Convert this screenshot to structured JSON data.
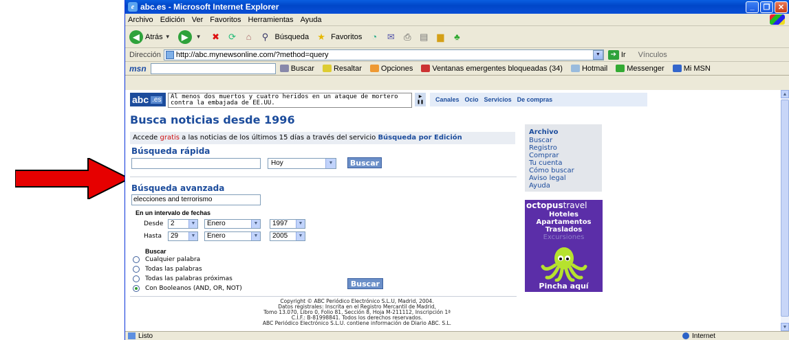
{
  "window": {
    "title": "abc.es - Microsoft Internet Explorer",
    "menu": [
      "Archivo",
      "Edición",
      "Ver",
      "Favoritos",
      "Herramientas",
      "Ayuda"
    ]
  },
  "toolbar": {
    "back_label": "Atrás",
    "search_label": "Búsqueda",
    "favorites_label": "Favoritos"
  },
  "address": {
    "label": "Dirección",
    "url": "http://abc.mynewsonline.com/?method=query",
    "go_label": "Ir",
    "links_label": "Vínculos"
  },
  "msn_bar": {
    "logo": "msn",
    "buscar": "Buscar",
    "resaltar": "Resaltar",
    "opciones": "Opciones",
    "popups": "Ventanas emergentes bloqueadas (34)",
    "hotmail": "Hotmail",
    "messenger": "Messenger",
    "mimsn": "Mi MSN"
  },
  "site": {
    "logo": "abc",
    "logo_suffix": ".es",
    "ticker": "Al menos dos muertos y cuatro heridos en un ataque de mortero contra la embajada de EE.UU.",
    "canales": "Canales",
    "ocio": "Ocio",
    "servicios": "Servicios",
    "compras": "De compras"
  },
  "page": {
    "heading": "Busca noticias desde 1996",
    "promo_pre": "Accede ",
    "promo_free": "gratis",
    "promo_mid": " a las noticias de los últimos 15 días a través del servicio ",
    "promo_link": "Búsqueda por Edición",
    "quick": {
      "title": "Búsqueda rápida",
      "query": "",
      "range": "Hoy",
      "button": "Buscar"
    },
    "advanced": {
      "title": "Búsqueda avanzada",
      "query": "elecciones and terrorismo",
      "interval_label": "En un intervalo de fechas",
      "from_label": "Desde",
      "from_day": "2",
      "from_month": "Enero",
      "from_year": "1997",
      "to_label": "Hasta",
      "to_day": "29",
      "to_month": "Enero",
      "to_year": "2005",
      "search_label": "Buscar",
      "options": [
        {
          "label": "Cualquier palabra",
          "selected": false
        },
        {
          "label": "Todas las palabras",
          "selected": false
        },
        {
          "label": "Todas las palabras próximas",
          "selected": false
        },
        {
          "label": "Con Booleanos (AND, OR, NOT)",
          "selected": true
        }
      ],
      "button": "Buscar"
    },
    "sidebar": {
      "head": "Archivo",
      "links": [
        "Buscar",
        "Registro",
        "Comprar",
        "Tu cuenta",
        "Cómo buscar",
        "Aviso legal",
        "Ayuda"
      ]
    },
    "ad": {
      "brand_a": "octopus",
      "brand_b": "travel",
      "lines": [
        "Hoteles",
        "Apartamentos",
        "Traslados"
      ],
      "faint": "Excursiones",
      "cta": "Pincha aquí"
    },
    "copyright": [
      "Copyright © ABC Periódico Electrónico S.L.U, Madrid, 2004.",
      "Datos registrales: Inscrita en el Registro Mercantil de Madrid,",
      "Tomo 13.070, Libro 0, Folio 81, Sección 8, Hoja M-211112, Inscripción 1ª",
      "C.I.F.: B-81998841. Todos los derechos reservados.",
      "ABC Periódico Electrónico S.L.U. contiene información de Diario ABC. S.L."
    ]
  },
  "status": {
    "text": "Listo",
    "zone": "Internet"
  },
  "colors": {
    "arrow": "#e60000",
    "brand": "#1c4c9c",
    "ad_bg": "#5b2ea8"
  }
}
